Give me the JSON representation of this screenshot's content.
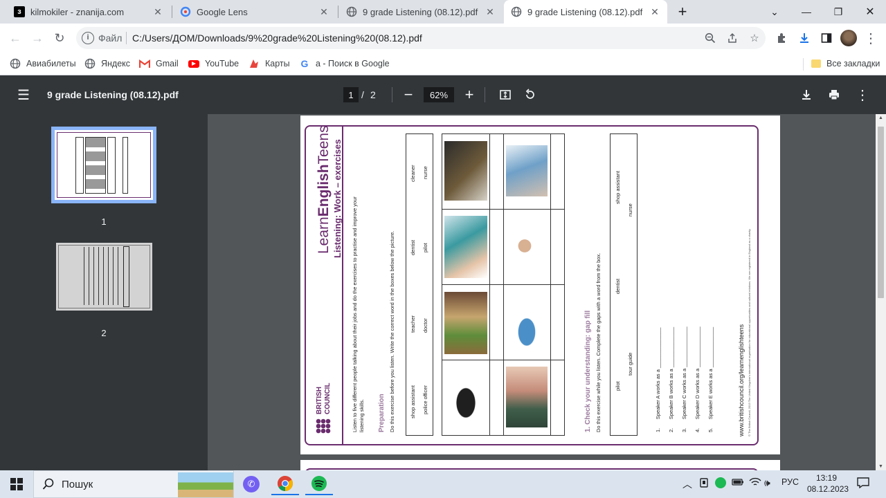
{
  "tabs": [
    {
      "title": "kilmokiler - znanija.com",
      "icon": "znanija-icon"
    },
    {
      "title": "Google Lens",
      "icon": "google-lens-icon"
    },
    {
      "title": "9 grade Listening (08.12).pdf",
      "icon": "globe-icon"
    },
    {
      "title": "9 grade Listening (08.12).pdf",
      "icon": "globe-icon",
      "active": true
    }
  ],
  "omnibox": {
    "scheme_label": "Файл",
    "url": "C:/Users/ДОМ/Downloads/9%20grade%20Listening%20(08.12).pdf"
  },
  "bookmarks": [
    {
      "label": "Авиабилеты",
      "icon": "globe-icon"
    },
    {
      "label": "Яндекс",
      "icon": "globe-icon"
    },
    {
      "label": "Gmail",
      "icon": "gmail-icon"
    },
    {
      "label": "YouTube",
      "icon": "youtube-icon"
    },
    {
      "label": "Карты",
      "icon": "maps-icon"
    },
    {
      "label": "а - Поиск в Google",
      "icon": "google-icon"
    }
  ],
  "bookmarks_all": "Все закладки",
  "pdf": {
    "title": "9 grade Listening (08.12).pdf",
    "current_page": "1",
    "page_sep": "/",
    "total_pages": "2",
    "zoom": "62%",
    "thumbs": [
      "1",
      "2"
    ]
  },
  "document": {
    "brand_light": "Learn",
    "brand_bold": "English",
    "brand_tail": "Teens",
    "heading": "Listening: Work – exercises",
    "intro": "Listen to five different people talking about their jobs and do the exercises to practise and improve your",
    "intro2": "listening skills.",
    "council1": "BRITISH",
    "council2": "COUNCIL",
    "prep_title": "Preparation",
    "prep_text": "Do this exercise before you listen. Write the correct word in the boxes below the picture.",
    "words1": [
      [
        "shop assistant",
        "police officer"
      ],
      [
        "teacher",
        "doctor"
      ],
      [
        "dentist",
        "pilot"
      ],
      [
        "cleaner",
        "nurse"
      ]
    ],
    "ex1_title": "1. Check your understanding: gap fill",
    "ex1_text": "Do this exercise while you listen. Complete the gaps with a word from the box.",
    "words2": [
      [
        "pilot",
        "tour guide"
      ],
      [
        "dentist",
        ""
      ],
      [
        "shop assistant",
        "nurse"
      ]
    ],
    "gaps": [
      {
        "n": "1.",
        "text": "Speaker A works as a"
      },
      {
        "n": "2.",
        "text": "Speaker B works as a"
      },
      {
        "n": "3.",
        "text": "Speaker C works as a"
      },
      {
        "n": "4.",
        "text": "Speaker D works as a"
      },
      {
        "n": "5.",
        "text": "Speaker E works as a"
      }
    ],
    "website": "www.britishcouncil.org/learnenglishteens",
    "copyright": "© The British Council, 2013 The United Kingdom's international organisation for educational opportunities and cultural relations. We are registered in England as a charity."
  },
  "taskbar": {
    "search": "Пошук",
    "lang": "РУС",
    "time": "13:19",
    "date": "08.12.2023"
  },
  "colors": {
    "accent": "#1a73e8",
    "pdf_bar": "#323639",
    "viewer_bg": "#525659",
    "lec_purple": "#6a2c6e"
  }
}
